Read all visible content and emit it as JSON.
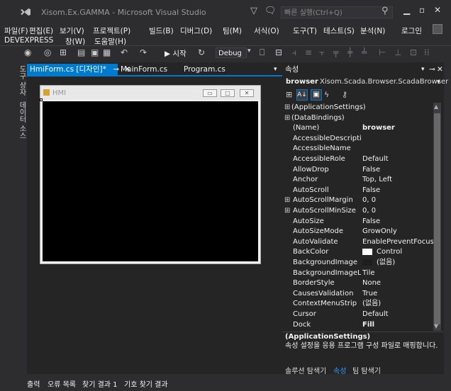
{
  "window": {
    "title": "Xisom.Ex.GAMMA - Microsoft Visual Studio",
    "quick_launch_placeholder": "빠른 실행(Ctrl+Q)",
    "user": "로그인"
  },
  "menu": {
    "row1": [
      "파일(F)",
      "편집(E)",
      "보기(V)",
      "프로젝트(P)",
      "빌드(B)",
      "디버그(D)",
      "팀(M)",
      "서식(O)",
      "도구(T)",
      "테스트(S)",
      "분석(N)"
    ],
    "row2": [
      "DEVEXPRESS",
      "창(W)",
      "도움말(H)"
    ]
  },
  "toolbar": {
    "start_label": "▶ 시작",
    "config": "Debug"
  },
  "left_strip": {
    "toolbox": "도구 상자",
    "datasources": "데이터 소스"
  },
  "tabs": {
    "active": "HmiForm.cs [디자인]*",
    "tab2": "MainForm.cs",
    "tab3": "Program.cs"
  },
  "form": {
    "caption": "HMI"
  },
  "properties": {
    "header": "속성",
    "object_name": "browser",
    "object_type": "Xisom.Scada.Browser.ScadaBrowser",
    "rows": [
      {
        "exp": "⊞",
        "name": "(ApplicationSettings)",
        "value": "",
        "group": true
      },
      {
        "exp": "⊞",
        "name": "(DataBindings)",
        "value": "",
        "group": true
      },
      {
        "exp": "",
        "name": "(Name)",
        "value": "browser",
        "bold": true
      },
      {
        "exp": "",
        "name": "AccessibleDescription",
        "value": ""
      },
      {
        "exp": "",
        "name": "AccessibleName",
        "value": ""
      },
      {
        "exp": "",
        "name": "AccessibleRole",
        "value": "Default"
      },
      {
        "exp": "",
        "name": "AllowDrop",
        "value": "False"
      },
      {
        "exp": "",
        "name": "Anchor",
        "value": "Top, Left"
      },
      {
        "exp": "",
        "name": "AutoScroll",
        "value": "False"
      },
      {
        "exp": "⊞",
        "name": "AutoScrollMargin",
        "value": "0, 0"
      },
      {
        "exp": "⊞",
        "name": "AutoScrollMinSize",
        "value": "0, 0"
      },
      {
        "exp": "",
        "name": "AutoSize",
        "value": "False"
      },
      {
        "exp": "",
        "name": "AutoSizeMode",
        "value": "GrowOnly"
      },
      {
        "exp": "",
        "name": "AutoValidate",
        "value": "EnablePreventFocusCha"
      },
      {
        "exp": "",
        "name": "BackColor",
        "value": "Control",
        "swatch": "#ffffff"
      },
      {
        "exp": "",
        "name": "BackgroundImage",
        "value": "(없음)",
        "swatch": "#1e1e1e"
      },
      {
        "exp": "",
        "name": "BackgroundImageLayo",
        "value": "Tile"
      },
      {
        "exp": "",
        "name": "BorderStyle",
        "value": "None"
      },
      {
        "exp": "",
        "name": "CausesValidation",
        "value": "True"
      },
      {
        "exp": "",
        "name": "ContextMenuStrip",
        "value": "(없음)"
      },
      {
        "exp": "",
        "name": "Cursor",
        "value": "Default"
      },
      {
        "exp": "",
        "name": "Dock",
        "value": "Fill",
        "bold": true
      }
    ],
    "desc_title": "(ApplicationSettings)",
    "desc_text": "속성 설정을 응용 프로그램 구성 파일로 매핑합니다.",
    "bottom_tabs": [
      "솔루션 탐색기",
      "속성",
      "팀 탐색기"
    ]
  },
  "output_tabs": [
    "출력",
    "오류 목록",
    "찾기 결과 1",
    "기호 찾기 결과"
  ],
  "colors": {
    "accent": "#007acc",
    "background": "#2d2d30"
  }
}
